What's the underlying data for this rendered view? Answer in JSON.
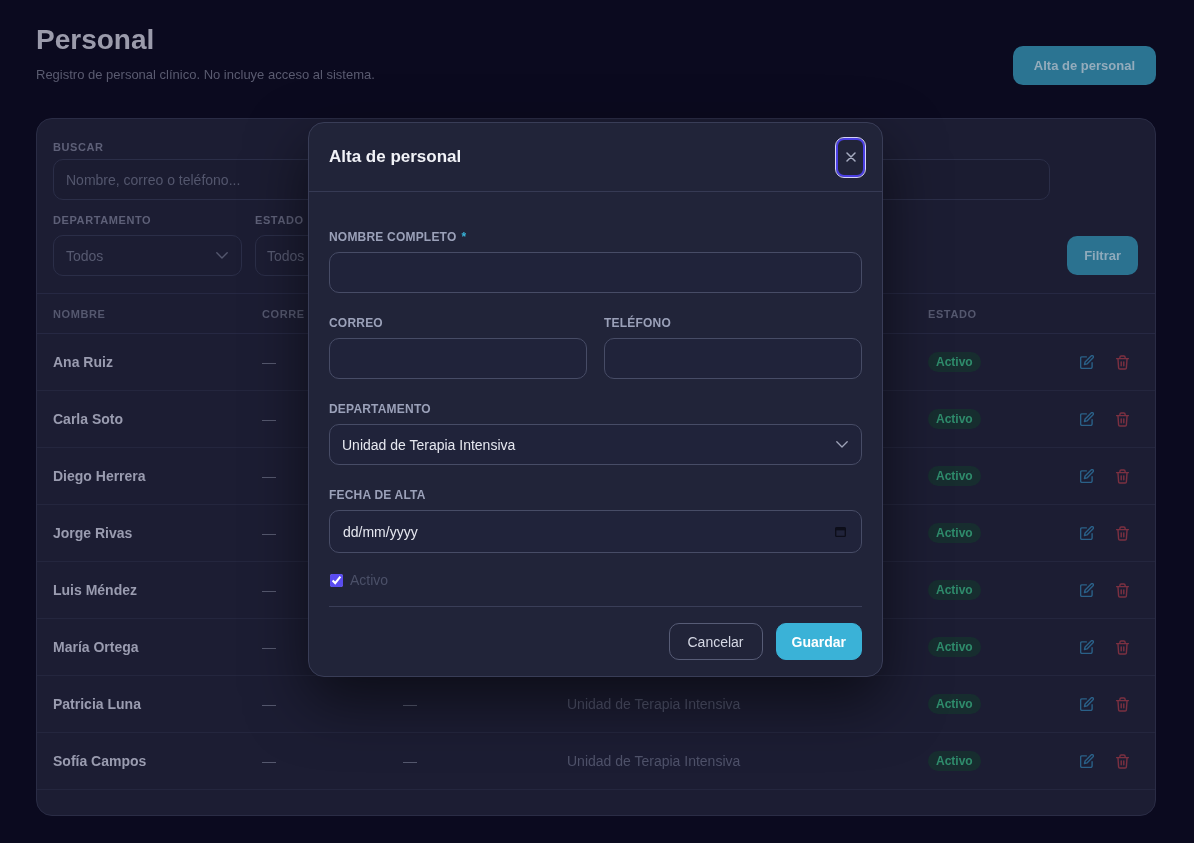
{
  "page": {
    "title": "Personal",
    "subtitle": "Registro de personal clínico. No incluye acceso al sistema.",
    "add_button": "Alta de personal"
  },
  "filters": {
    "search": {
      "label": "BUSCAR",
      "placeholder": "Nombre, correo o teléfono..."
    },
    "department": {
      "label": "DEPARTAMENTO",
      "value": "Todos"
    },
    "status": {
      "label": "ESTADO",
      "value": "Todos"
    },
    "filter_button": "Filtrar"
  },
  "table": {
    "header": {
      "name": "NOMBRE",
      "column_2": "CORRE",
      "status": "ESTADO"
    },
    "rows": [
      {
        "name": "Ana Ruiz",
        "column_2": "—",
        "status": "Activo"
      },
      {
        "name": "Carla Soto",
        "column_2": "—",
        "status": "Activo"
      },
      {
        "name": "Diego Herrera",
        "column_2": "—",
        "status": "Activo"
      },
      {
        "name": "Jorge Rivas",
        "column_2": "—",
        "status": "Activo"
      },
      {
        "name": "Luis Méndez",
        "column_2": "—",
        "status": "Activo"
      },
      {
        "name": "María Ortega",
        "column_2": "—",
        "status": "Activo"
      },
      {
        "name": "Patricia Luna",
        "column_2": "—",
        "column_3": "—",
        "column_4": "Unidad de Terapia Intensiva",
        "status": "Activo"
      },
      {
        "name": "Sofía Campos",
        "column_2": "—",
        "column_3": "—",
        "column_4": "Unidad de Terapia Intensiva",
        "status": "Activo"
      }
    ]
  },
  "dialog": {
    "title": "Alta de personal",
    "close_button": {
      "focused": true
    },
    "form_rows": [
      [
        {
          "kind": "text",
          "label": "NOMBRE COMPLETO",
          "required_mark": "*"
        }
      ],
      [
        {
          "kind": "text",
          "label": "CORREO"
        },
        {
          "kind": "text",
          "label": "TELÉFONO"
        }
      ],
      [
        {
          "kind": "select",
          "label": "DEPARTAMENTO",
          "value": "Unidad de Terapia Intensiva"
        }
      ],
      [
        {
          "kind": "date",
          "label": "FECHA DE ALTA",
          "placeholder": "dd/mm/yyyy"
        }
      ]
    ],
    "checkbox": {
      "label": "Activo",
      "checked": true
    },
    "buttons": [
      {
        "kind": "secondary",
        "label": "Cancelar"
      },
      {
        "kind": "primary",
        "label": "Guardar"
      }
    ]
  }
}
